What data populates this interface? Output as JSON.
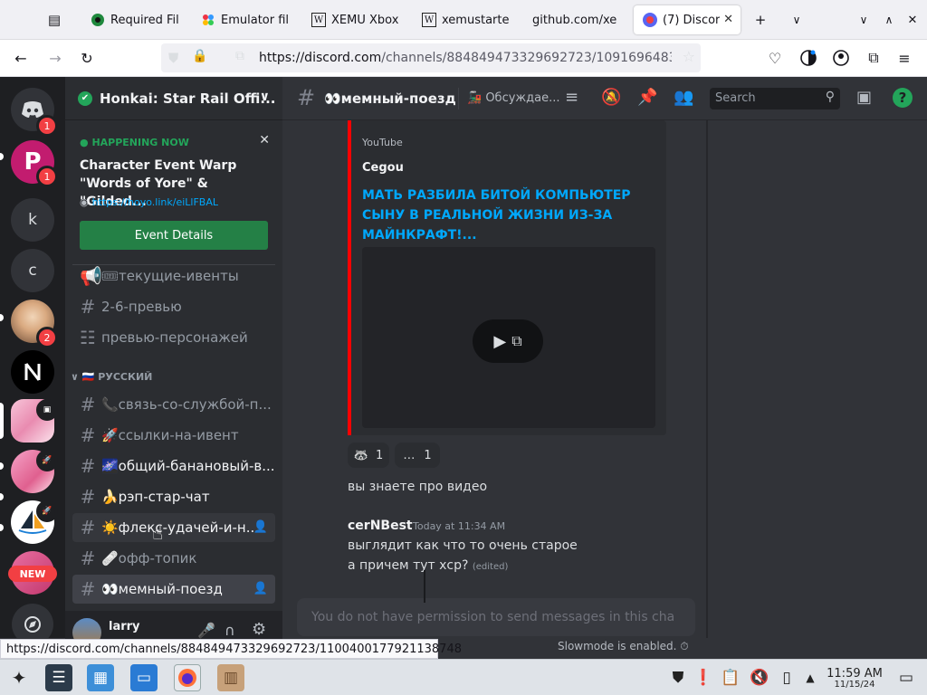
{
  "browser": {
    "tabs": [
      {
        "label": "Required Fil",
        "icon": "github-icon"
      },
      {
        "label": "Emulator fil",
        "icon": "grid-icon"
      },
      {
        "label": "XEMU Xbox",
        "icon": "wikipedia-icon"
      },
      {
        "label": "xemustarte",
        "icon": "wikipedia-icon"
      },
      {
        "label": "github.com/xe",
        "icon": "none"
      },
      {
        "label": "(7) Discor",
        "icon": "discord-icon"
      }
    ],
    "url_host": "https://discord.com",
    "url_path": "/channels/884849473329692723/10916964830751"
  },
  "servers": [
    {
      "label": "",
      "icon": "discord-home-icon",
      "badge": "1"
    },
    {
      "label": "P",
      "icon": "p-logo-icon",
      "badge": "1"
    },
    {
      "label": "k",
      "icon": "",
      "badge": ""
    },
    {
      "label": "c",
      "icon": "",
      "badge": ""
    },
    {
      "label": "",
      "icon": "avatar-photo",
      "badge": "2"
    },
    {
      "label": "",
      "icon": "slash-logo-icon",
      "badge": ""
    },
    {
      "label": "",
      "icon": "anime-server-icon",
      "badge": ""
    },
    {
      "label": "",
      "icon": "pink-anime-icon",
      "badge": ""
    },
    {
      "label": "",
      "icon": "sailboat-icon",
      "badge": ""
    },
    {
      "label": "NEW",
      "icon": "new-server-icon",
      "badge": ""
    }
  ],
  "server": {
    "name": "Honkai: Star Rail Offi..."
  },
  "event": {
    "status": "HAPPENING NOW",
    "title": "Character Event Warp \"Words of Yore\" & \"Gilded...",
    "link": "https://hoyo.link/eiLlFBAL",
    "button": "Event Details"
  },
  "channels_top": [
    {
      "label": "🎟текущие-ивенты",
      "kind": "announce"
    },
    {
      "label": "2-6-превью",
      "kind": "hash"
    },
    {
      "label": "превью-персонажей",
      "kind": "forum"
    }
  ],
  "category": "🇷🇺 РУССКИЙ",
  "channels": [
    {
      "label": "📞связь-со-службой-п...",
      "bright": false,
      "selected": false
    },
    {
      "label": "🚀ссылки-на-ивент",
      "bright": false,
      "selected": false
    },
    {
      "label": "🌌общий-банановый-в...",
      "bright": true,
      "selected": false
    },
    {
      "label": "🍌рэп-стар-чат",
      "bright": true,
      "selected": false
    },
    {
      "label": "☀️флекс-удачей-и-н...",
      "bright": true,
      "selected": false,
      "hover": true
    },
    {
      "label": "🩹офф-топик",
      "bright": false,
      "selected": false
    },
    {
      "label": "👀мемный-поезд",
      "bright": true,
      "selected": true
    }
  ],
  "user": {
    "name": "larry"
  },
  "channel_header": {
    "name": "👀мемный-поезд",
    "thread": "🚂 Обсуждае...",
    "search_placeholder": "Search"
  },
  "embed": {
    "provider": "YouTube",
    "author": "Cegou",
    "title": "МАТЬ РАЗБИЛА БИТОЙ КОМПЬЮТЕР СЫНУ В РЕАЛЬНОЙ ЖИЗНИ ИЗ-ЗА МАЙНКРАФТ!..."
  },
  "reactions": [
    {
      "emoji": "🦝",
      "count": "1"
    },
    {
      "emoji": "…",
      "count": "1"
    }
  ],
  "messages": [
    {
      "author": "",
      "time": "",
      "lines": [
        "вы знаете про видео"
      ]
    },
    {
      "author": "cerNBest",
      "time": "Today at 11:34 AM",
      "lines": [
        "выглядит как что то очень старое",
        "а причем тут хср?"
      ],
      "edited": "(edited)"
    }
  ],
  "composer": {
    "placeholder": "You do not have permission to send messages in this cha..."
  },
  "slowmode": "Slowmode is enabled.",
  "status_url": "https://discord.com/channels/884849473329692723/1100400177921138748",
  "clock": {
    "time": "11:59 AM",
    "date": "11/15/24"
  },
  "colors": {
    "blurple": "#5865f2",
    "green": "#248046",
    "red": "#f23f43",
    "link": "#00a8fc"
  }
}
